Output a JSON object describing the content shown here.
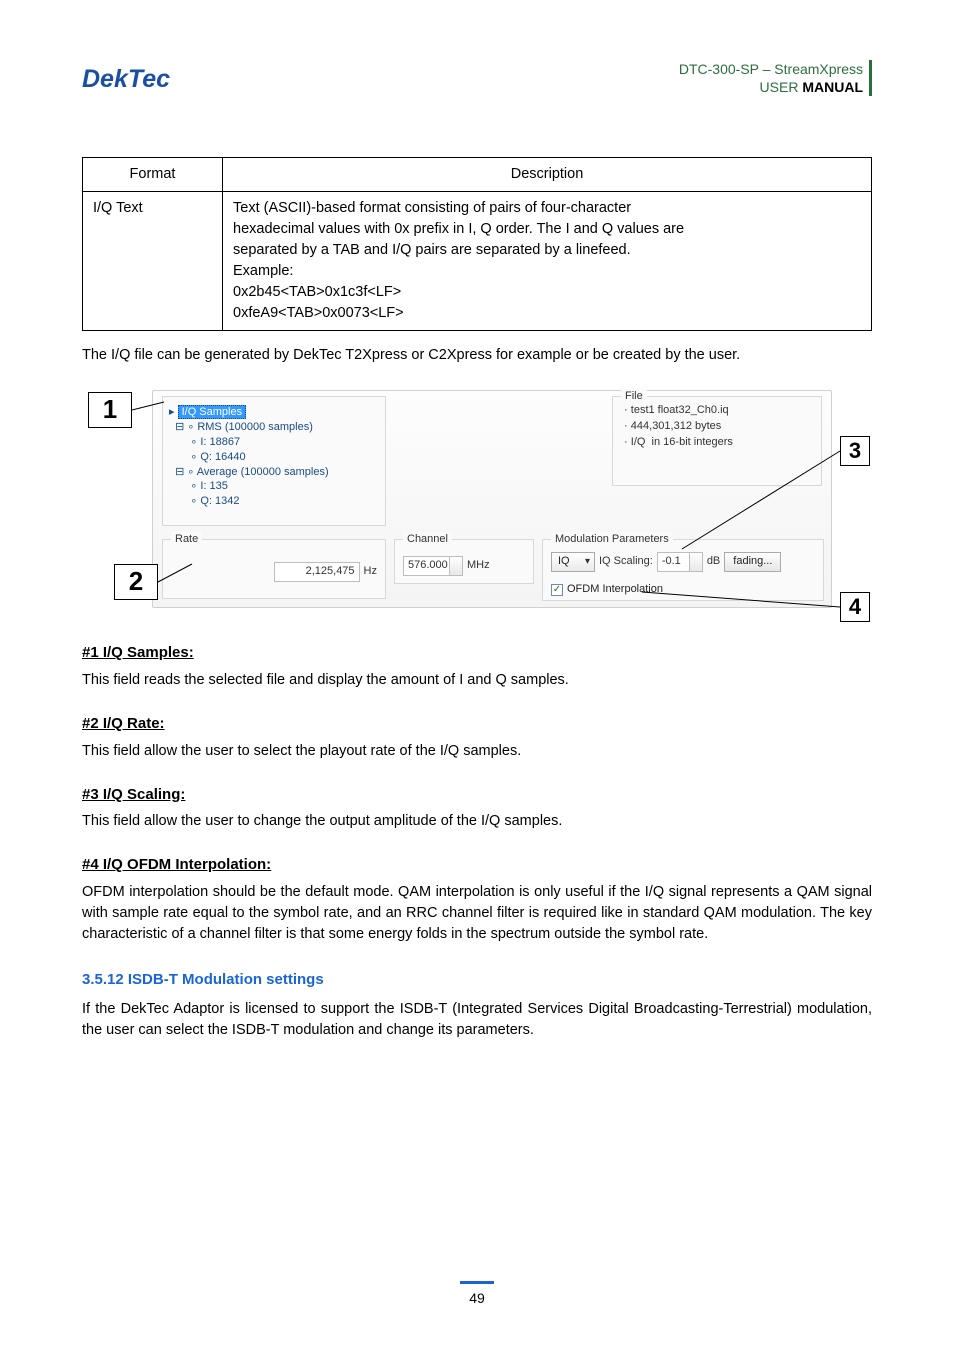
{
  "header": {
    "product": "DTC-300-SP – StreamXpress",
    "doc_line_prefix": "USER ",
    "doc_line_bold": "MANUAL"
  },
  "table": {
    "h1": "Format",
    "h2": "Description",
    "c1": "I/Q Text",
    "c2_l1": "Text (ASCII)-based format consisting of pairs of four-character",
    "c2_l2": "hexadecimal values with 0x prefix in I, Q order. The I and Q values are",
    "c2_l3": "separated by a TAB and I/Q pairs are separated by a linefeed.",
    "c2_l4": "Example:",
    "c2_l5": "0x2b45<TAB>0x1c3f<LF>",
    "c2_l6": "0xfeA9<TAB>0x0073<LF>"
  },
  "para_after_table": "The I/Q file can be generated by DekTec T2Xpress or C2Xpress for example or be created by the user.",
  "shot": {
    "samples_title": "I/Q Samples",
    "rms": "RMS (100000 samples)",
    "rms_i": "I: 18867",
    "rms_q": "Q: 16440",
    "avg": "Average (100000 samples)",
    "avg_i": "I: 135",
    "avg_q": "Q: 1342",
    "rate_title": "Rate",
    "rate_val": "2,125,475",
    "rate_unit": "Hz",
    "channel_title": "Channel",
    "channel_val": "576.000",
    "channel_unit": "MHz",
    "file_title": "File",
    "file_name": "test1 float32_Ch0.iq",
    "file_bytes": "444,301,312 bytes",
    "file_fmt": "I/Q  in 16-bit integers",
    "mod_title": "Modulation Parameters",
    "iq_combo": "IQ",
    "iq_scaling_lbl": "IQ Scaling:",
    "iq_scaling_val": "-0.1",
    "iq_scaling_unit": "dB",
    "fading_btn": "fading...",
    "ofdm_chk": "OFDM Interpolation",
    "c1": "1",
    "c2": "2",
    "c3": "3",
    "c4": "4"
  },
  "s1_h": "#1 I/Q  Samples:",
  "s1_p": "This field reads the selected file and display the amount of I and Q  samples.",
  "s2_h": "#2 I/Q  Rate:",
  "s2_p": "This field allow the user to select the playout rate of the I/Q samples.",
  "s3_h": "#3 I/Q  Scaling:",
  "s3_p": "This field allow the user to change the output amplitude of the I/Q samples.",
  "s4_h": "#4 I/Q  OFDM Interpolation:",
  "s4_p": "OFDM interpolation should be the default mode. QAM interpolation is only useful if the I/Q signal represents a QAM signal with sample rate equal to the symbol rate, and an RRC channel filter is required like in standard QAM modulation. The key characteristic of a channel filter is that some energy folds in the spectrum outside the symbol rate.",
  "sec_h": "3.5.12 ISDB-T Modulation settings",
  "sec_p": "If the DekTec Adaptor is licensed to support the ISDB-T (Integrated Services Digital Broadcasting-Terrestrial) modulation, the user can select the ISDB-T modulation and change its parameters.",
  "page_num": "49"
}
